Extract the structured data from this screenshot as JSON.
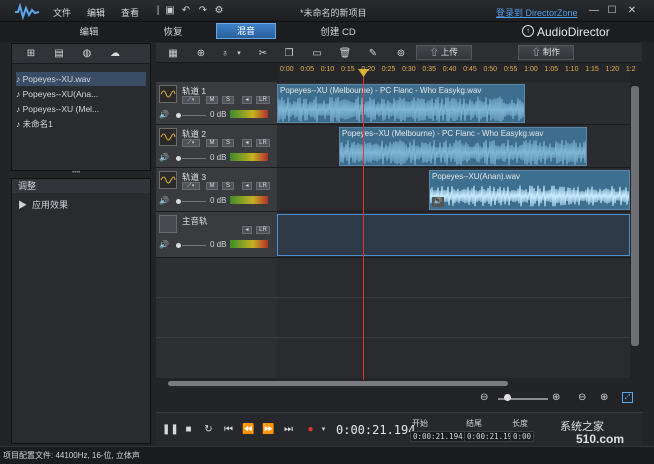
{
  "menu": {
    "file": "文件",
    "edit": "编辑",
    "view": "查看"
  },
  "doc_title": "*未命名的新项目",
  "login": "登录到 DirectorZone",
  "modes": {
    "edit": "编辑",
    "restore": "恢复",
    "mix": "混音",
    "create_cd": "创建 CD"
  },
  "brand": "AudioDirector",
  "library": {
    "items": [
      "Popeyes--XU.wav",
      "Popeyes--XU(Ana...",
      "Popeyes--XU (Mel...",
      "未命名1"
    ]
  },
  "adjust": {
    "title": "调整",
    "effects": "应用效果"
  },
  "toolbar": {
    "upload": "上传",
    "produce": "制作"
  },
  "ruler": [
    "0:00",
    "0:05",
    "0:10",
    "0:15",
    "0:20",
    "0:25",
    "0:30",
    "0:35",
    "0:40",
    "0:45",
    "0:50",
    "0:55",
    "1:00",
    "1:05",
    "1:10",
    "1:15",
    "1:20",
    "1:2"
  ],
  "tracks": [
    {
      "name": "轨道 1",
      "vol": "0 dB",
      "clip": "Popeyes--XU (Melbourne) - PC Flanc - Who Easykg.wav"
    },
    {
      "name": "轨道 2",
      "vol": "0 dB",
      "clip": "Popeyes--XU (Melbourne) - PC Flanc - Who Easykg.wav"
    },
    {
      "name": "轨道 3",
      "vol": "0 dB",
      "clip": "Popeyes--XU(Anan).wav"
    },
    {
      "name": "主音轨",
      "vol": "0 dB",
      "clip": ""
    }
  ],
  "buttons": {
    "m": "M",
    "s": "S",
    "lr": "LR"
  },
  "transport": {
    "timecode": "0:00:21.194",
    "start_label": "开始",
    "end_label": "结尾",
    "length_label": "长度",
    "start_val": "0:00:21.194",
    "end_val": "0:00:21.194",
    "length_val": "0:00"
  },
  "status": "项目配置文件: 44100Hz, 16-位, 立体声",
  "watermark": {
    "line1": "系统之家",
    "line2": "510.com"
  },
  "colors": {
    "accent": "#3a80c8",
    "playhead": "#e03434",
    "wave": "#7fb6d6"
  }
}
